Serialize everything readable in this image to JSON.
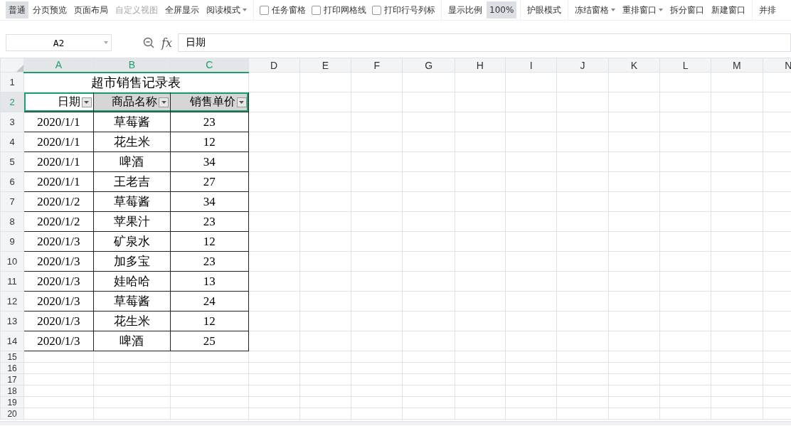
{
  "toolbar": [
    {
      "kind": "button",
      "label": "普通",
      "selected": true
    },
    {
      "kind": "button",
      "label": "分页预览",
      "selected": false
    },
    {
      "kind": "button",
      "label": "页面布局",
      "selected": false
    },
    {
      "kind": "button",
      "label": "自定义视图",
      "selected": false,
      "disabled": true
    },
    {
      "kind": "button",
      "label": "全屏显示",
      "selected": false
    },
    {
      "kind": "dropdown",
      "label": "阅读模式",
      "selected": false
    },
    {
      "kind": "separator"
    },
    {
      "kind": "checkbox",
      "label": "任务窗格",
      "checked": false
    },
    {
      "kind": "checkbox",
      "label": "打印网格线",
      "checked": false
    },
    {
      "kind": "checkbox",
      "label": "打印行号列标",
      "checked": false
    },
    {
      "kind": "separator"
    },
    {
      "kind": "button",
      "label": "显示比例",
      "selected": false
    },
    {
      "kind": "button",
      "label": "100%",
      "selected": true
    },
    {
      "kind": "separator"
    },
    {
      "kind": "button",
      "label": "护眼模式",
      "selected": false
    },
    {
      "kind": "separator"
    },
    {
      "kind": "dropdown",
      "label": "冻结窗格",
      "selected": false
    },
    {
      "kind": "dropdown",
      "label": "重排窗口",
      "selected": false
    },
    {
      "kind": "button",
      "label": "拆分窗口",
      "selected": false
    },
    {
      "kind": "button",
      "label": "新建窗口",
      "selected": false
    },
    {
      "kind": "separator"
    },
    {
      "kind": "button",
      "label": "并排",
      "selected": false
    }
  ],
  "name_box": "A2",
  "formula_bar": {
    "fx": "fx",
    "value": "日期"
  },
  "columns": [
    {
      "label": "A",
      "selected": true
    },
    {
      "label": "B",
      "selected": true
    },
    {
      "label": "C",
      "selected": true
    },
    {
      "label": "D",
      "selected": false
    },
    {
      "label": "E",
      "selected": false
    },
    {
      "label": "F",
      "selected": false
    },
    {
      "label": "G",
      "selected": false
    },
    {
      "label": "H",
      "selected": false
    },
    {
      "label": "I",
      "selected": false
    },
    {
      "label": "J",
      "selected": false
    },
    {
      "label": "K",
      "selected": false
    },
    {
      "label": "L",
      "selected": false
    },
    {
      "label": "M",
      "selected": false
    },
    {
      "label": "N",
      "selected": false
    }
  ],
  "rows": [
    {
      "number": "1",
      "selected": false,
      "kind": "title",
      "cells": [
        {
          "text": "超市销售记录表"
        }
      ]
    },
    {
      "number": "2",
      "selected": true,
      "kind": "header",
      "cells": [
        {
          "text": "日期",
          "active": true
        },
        {
          "text": "商品名称",
          "active": false
        },
        {
          "text": "销售单价",
          "active": false
        }
      ]
    },
    {
      "number": "3",
      "selected": false,
      "kind": "data",
      "cells": [
        {
          "text": "2020/1/1"
        },
        {
          "text": "草莓酱"
        },
        {
          "text": "23"
        }
      ]
    },
    {
      "number": "4",
      "selected": false,
      "kind": "data",
      "cells": [
        {
          "text": "2020/1/1"
        },
        {
          "text": "花生米"
        },
        {
          "text": "12"
        }
      ]
    },
    {
      "number": "5",
      "selected": false,
      "kind": "data",
      "cells": [
        {
          "text": "2020/1/1"
        },
        {
          "text": "啤酒"
        },
        {
          "text": "34"
        }
      ]
    },
    {
      "number": "6",
      "selected": false,
      "kind": "data",
      "cells": [
        {
          "text": "2020/1/1"
        },
        {
          "text": "王老吉"
        },
        {
          "text": "27"
        }
      ]
    },
    {
      "number": "7",
      "selected": false,
      "kind": "data",
      "cells": [
        {
          "text": "2020/1/2"
        },
        {
          "text": "草莓酱"
        },
        {
          "text": "34"
        }
      ]
    },
    {
      "number": "8",
      "selected": false,
      "kind": "data",
      "cells": [
        {
          "text": "2020/1/2"
        },
        {
          "text": "苹果汁"
        },
        {
          "text": "23"
        }
      ]
    },
    {
      "number": "9",
      "selected": false,
      "kind": "data",
      "cells": [
        {
          "text": "2020/1/3"
        },
        {
          "text": "矿泉水"
        },
        {
          "text": "12"
        }
      ]
    },
    {
      "number": "10",
      "selected": false,
      "kind": "data",
      "cells": [
        {
          "text": "2020/1/3"
        },
        {
          "text": "加多宝"
        },
        {
          "text": "23"
        }
      ]
    },
    {
      "number": "11",
      "selected": false,
      "kind": "data",
      "cells": [
        {
          "text": "2020/1/3"
        },
        {
          "text": "娃哈哈"
        },
        {
          "text": "13"
        }
      ]
    },
    {
      "number": "12",
      "selected": false,
      "kind": "data",
      "cells": [
        {
          "text": "2020/1/3"
        },
        {
          "text": "草莓酱"
        },
        {
          "text": "24"
        }
      ]
    },
    {
      "number": "13",
      "selected": false,
      "kind": "data",
      "cells": [
        {
          "text": "2020/1/3"
        },
        {
          "text": "花生米"
        },
        {
          "text": "12"
        }
      ]
    },
    {
      "number": "14",
      "selected": false,
      "kind": "data",
      "cells": [
        {
          "text": "2020/1/3"
        },
        {
          "text": "啤酒"
        },
        {
          "text": "25"
        }
      ]
    },
    {
      "number": "15",
      "selected": false,
      "kind": "empty"
    },
    {
      "number": "16",
      "selected": false,
      "kind": "empty"
    },
    {
      "number": "17",
      "selected": false,
      "kind": "empty"
    },
    {
      "number": "18",
      "selected": false,
      "kind": "empty"
    },
    {
      "number": "19",
      "selected": false,
      "kind": "empty"
    },
    {
      "number": "20",
      "selected": false,
      "kind": "empty"
    }
  ]
}
